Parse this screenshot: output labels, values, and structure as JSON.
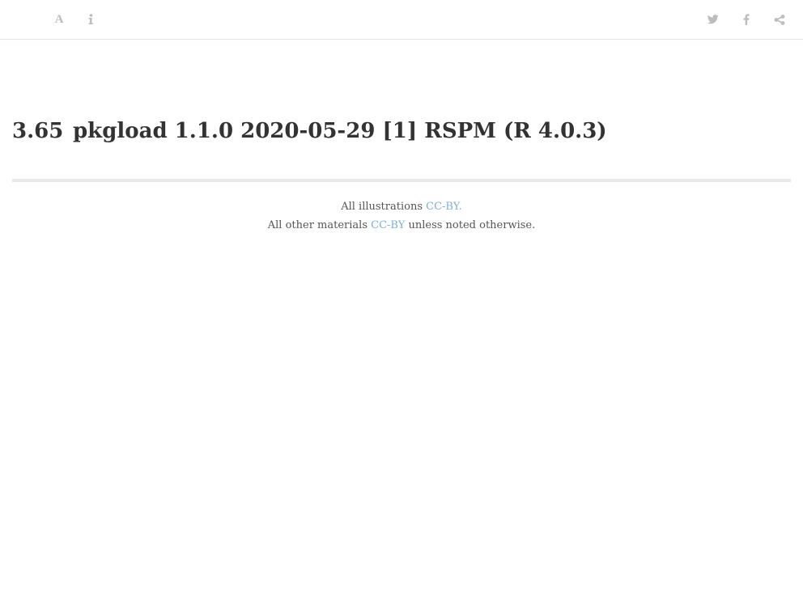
{
  "toolbar": {
    "left_buttons": [
      {
        "name": "font-settings",
        "icon": "font-icon"
      },
      {
        "name": "info",
        "icon": "info-icon"
      }
    ],
    "right_buttons": [
      {
        "name": "twitter",
        "icon": "twitter-icon"
      },
      {
        "name": "facebook",
        "icon": "facebook-icon"
      },
      {
        "name": "share",
        "icon": "share-icon"
      }
    ],
    "icon_color": "#bdbdbd"
  },
  "heading": {
    "section_number": "3.65",
    "title": "pkgload 1.1.0 2020-05-29 [1] RSPM (R 4.0.3)"
  },
  "footer": {
    "line1_prefix": "All illustrations ",
    "line1_link": "CC-BY.",
    "line2_prefix": "All other materials ",
    "line2_link": "CC-BY",
    "line2_suffix": " unless noted otherwise.",
    "link_color": "#7fb0d6"
  }
}
